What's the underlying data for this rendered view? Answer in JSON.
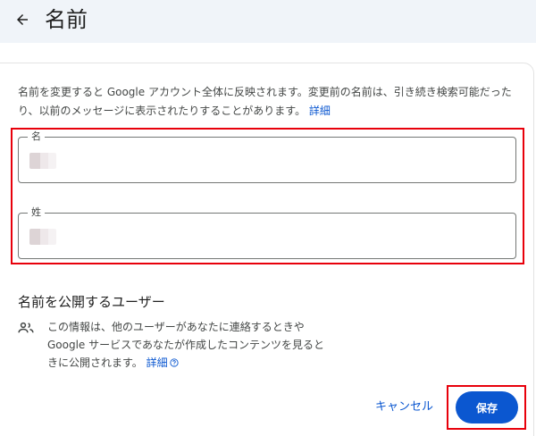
{
  "header": {
    "title": "名前",
    "back_icon": "arrow-left-icon"
  },
  "description": {
    "text": "名前を変更すると Google アカウント全体に反映されます。変更前の名前は、引き続き検索可能だったり、以前のメッセージに表示されたりすることがあります。",
    "link": "詳細"
  },
  "fields": [
    {
      "label": "名"
    },
    {
      "label": "姓"
    }
  ],
  "visibility": {
    "title": "名前を公開するユーザー",
    "icon": "people-icon",
    "line1": "この情報は、他のユーザーがあなたに連絡するときや",
    "line2": "Google サービスであなたが作成したコンテンツを見ると",
    "line3": "きに公開されます。",
    "link": "詳細",
    "help_icon": "help-circle-icon"
  },
  "actions": {
    "cancel": "キャンセル",
    "save": "保存"
  },
  "colors": {
    "accent": "#0b57d0",
    "highlight": "#e8000b",
    "header_bg": "#f0f4f9"
  }
}
